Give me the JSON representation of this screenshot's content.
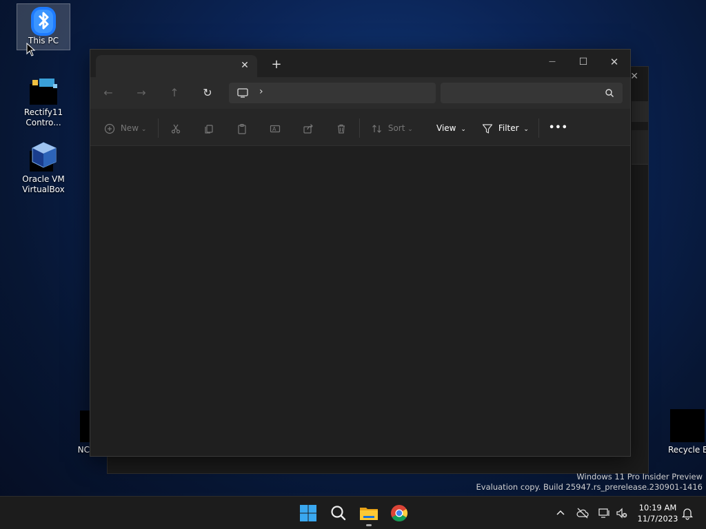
{
  "desktop": {
    "icons": [
      {
        "label": "This PC",
        "icon": "bluetooth-icon"
      },
      {
        "label": "Rectify11\nContro...",
        "icon": "control-panel-icon"
      },
      {
        "label": "Oracle VM\nVirtualBox",
        "icon": "virtualbox-icon"
      },
      {
        "label": "NC",
        "icon": "partially-hidden-icon"
      },
      {
        "label": "Recycle Bin",
        "icon": "recycle-bin-icon"
      }
    ]
  },
  "explorer": {
    "tab": {
      "title": "",
      "close_glyph": "✕"
    },
    "new_tab_glyph": "+",
    "window_controls": {
      "minimize": "—",
      "maximize": "☐",
      "close": "✕"
    },
    "nav": {
      "back": "←",
      "forward": "→",
      "up": "↑",
      "refresh": "↻"
    },
    "address": {
      "separator": "›"
    },
    "search": {
      "placeholder": "",
      "value": ""
    },
    "toolbar": {
      "new_label": "New",
      "sort_label": "Sort",
      "view_label": "View",
      "filter_label": "Filter",
      "more_label": "•••"
    }
  },
  "watermark": {
    "line1": "Windows 11 Pro Insider Preview",
    "line2": "Evaluation copy. Build 25947.rs_prerelease.230901-1416"
  },
  "taskbar": {
    "apps": [
      "start-icon",
      "search-icon",
      "file-explorer-icon",
      "chrome-icon"
    ],
    "tray": [
      "chevron-up-icon",
      "cloud-off-icon",
      "network-icon",
      "volume-muted-icon"
    ],
    "clock": {
      "time": "10:19 AM",
      "date": "11/7/2023"
    }
  },
  "colors": {
    "accent": "#0078d4",
    "window_bg": "#1f1f1f",
    "taskbar_bg": "#1c1c1c"
  }
}
